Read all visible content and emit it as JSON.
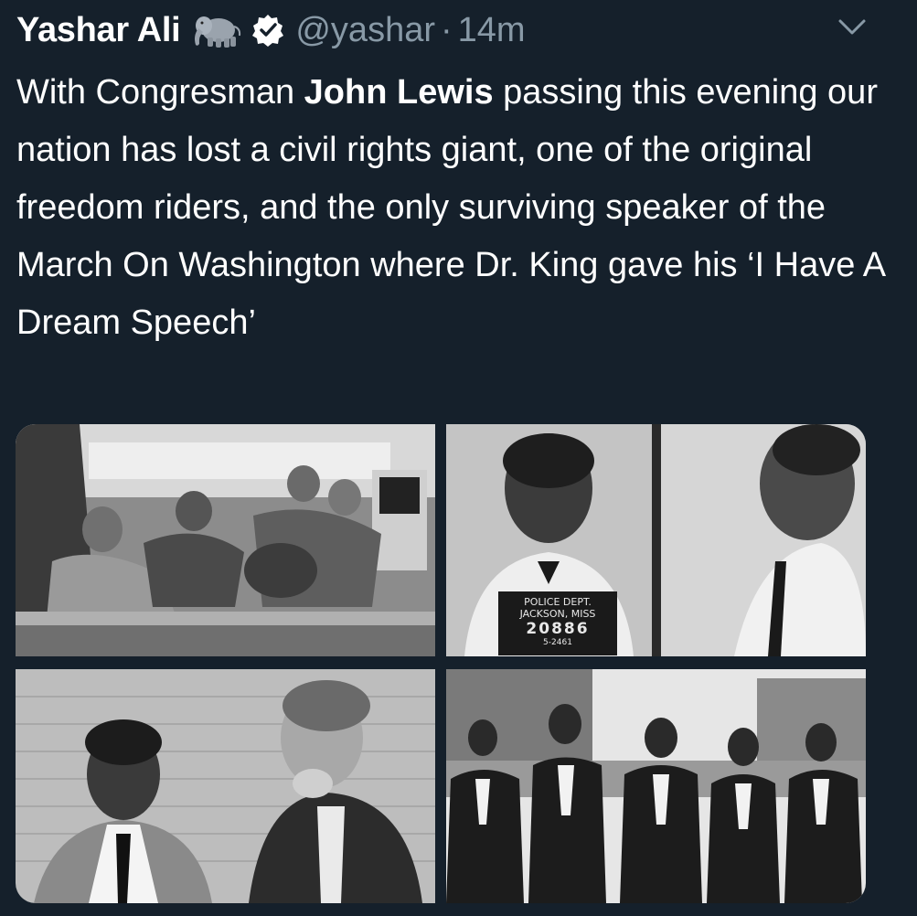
{
  "tweet": {
    "display_name": "Yashar Ali",
    "emoji_icon": "elephant-icon",
    "verified_icon": "verified-badge-icon",
    "handle": "@yashar",
    "separator": "·",
    "time": "14m",
    "menu_icon": "chevron-down-icon",
    "text": {
      "part1": "With Congresman ",
      "bold": "John Lewis",
      "part2": " passing this evening our nation has lost a civil rights giant, one of the original freedom riders, and the only surviving speaker of the March On Washington where Dr. King gave his ‘I Have A Dream Speech’"
    }
  },
  "media": {
    "photos": [
      {
        "name": "lunch-counter-sit-in-photo"
      },
      {
        "name": "mugshot-photo",
        "placard": {
          "line1": "POLICE   DEPT.",
          "line2": "JACKSON, MISS",
          "number": "20886",
          "sub": "5-2461"
        }
      },
      {
        "name": "freedom-riders-photo"
      },
      {
        "name": "march-photo"
      }
    ]
  },
  "colors": {
    "background": "#15202b",
    "text": "#ffffff",
    "secondary": "#8899a6"
  }
}
